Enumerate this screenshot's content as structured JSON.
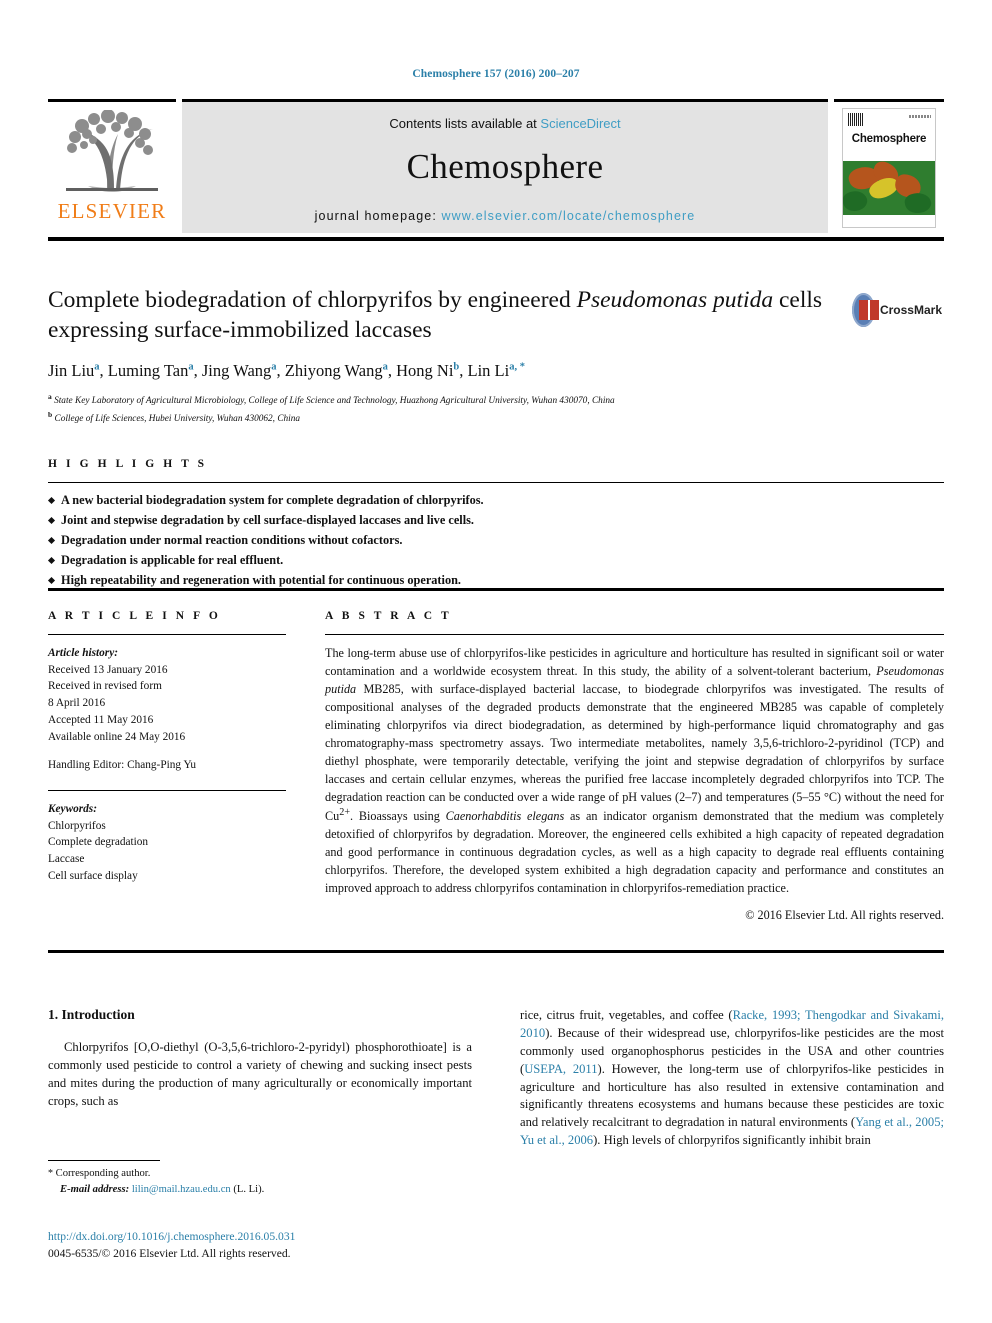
{
  "running_head": "Chemosphere 157 (2016) 200–207",
  "masthead": {
    "publisher_logo_label": "ELSEVIER",
    "contents_prefix": "Contents lists available at",
    "contents_link": "ScienceDirect",
    "journal_title": "Chemosphere",
    "homepage_prefix": "journal homepage:",
    "homepage_url": "www.elsevier.com/locate/chemosphere",
    "cover_journal_name": "Chemosphere"
  },
  "article": {
    "title_part1": "Complete biodegradation of chlorpyrifos by engineered ",
    "title_italic1": "Pseudomonas putida",
    "title_part2": " cells expressing surface-immobilized laccases",
    "crossmark_label": "CrossMark",
    "authors": [
      {
        "name": "Jin Liu",
        "marks": "a"
      },
      {
        "name": "Luming Tan",
        "marks": "a"
      },
      {
        "name": "Jing Wang",
        "marks": "a"
      },
      {
        "name": "Zhiyong Wang",
        "marks": "a"
      },
      {
        "name": "Hong Ni",
        "marks": "b"
      },
      {
        "name": "Lin Li",
        "marks": "a, *"
      }
    ],
    "affiliations": [
      {
        "mark": "a",
        "text": "State Key Laboratory of Agricultural Microbiology, College of Life Science and Technology, Huazhong Agricultural University, Wuhan 430070, China"
      },
      {
        "mark": "b",
        "text": "College of Life Sciences, Hubei University, Wuhan 430062, China"
      }
    ]
  },
  "highlights": {
    "heading": "H I G H L I G H T S",
    "items": [
      "A new bacterial biodegradation system for complete degradation of chlorpyrifos.",
      "Joint and stepwise degradation by cell surface-displayed laccases and live cells.",
      "Degradation under normal reaction conditions without cofactors.",
      "Degradation is applicable for real effluent.",
      "High repeatability and regeneration with potential for continuous operation."
    ]
  },
  "article_info": {
    "heading": "A R T I C L E  I N F O",
    "history_label": "Article history:",
    "history_lines": [
      "Received 13 January 2016",
      "Received in revised form",
      "8 April 2016",
      "Accepted 11 May 2016",
      "Available online 24 May 2016"
    ],
    "handling_editor": "Handling Editor: Chang-Ping Yu",
    "keywords_label": "Keywords:",
    "keywords": [
      "Chlorpyrifos",
      "Complete degradation",
      "Laccase",
      "Cell surface display"
    ]
  },
  "abstract": {
    "heading": "A B S T R A C T",
    "text_p1": "The long-term abuse use of chlorpyrifos-like pesticides in agriculture and horticulture has resulted in significant soil or water contamination and a worldwide ecosystem threat. In this study, the ability of a solvent-tolerant bacterium, ",
    "italic1": "Pseudomonas putida",
    "text_p2": " MB285, with surface-displayed bacterial laccase, to biodegrade chlorpyrifos was investigated. The results of compositional analyses of the degraded products demonstrate that the engineered MB285 was capable of completely eliminating chlorpyrifos via direct biodegradation, as determined by high-performance liquid chromatography and gas chromatography-mass spectrometry assays. Two intermediate metabolites, namely 3,5,6-trichloro-2-pyridinol (TCP) and diethyl phosphate, were temporarily detectable, verifying the joint and stepwise degradation of chlorpyrifos by surface laccases and certain cellular enzymes, whereas the purified free laccase incompletely degraded chlorpyrifos into TCP. The degradation reaction can be conducted over a wide range of pH values (2–7) and temperatures (5–55 °C) without the need for Cu",
    "sup1": "2+",
    "text_p3": ". Bioassays using ",
    "italic2": "Caenorhabditis elegans",
    "text_p4": " as an indicator organism demonstrated that the medium was completely detoxified of chlorpyrifos by degradation. Moreover, the engineered cells exhibited a high capacity of repeated degradation and good performance in continuous degradation cycles, as well as a high capacity to degrade real effluents containing chlorpyrifos. Therefore, the developed system exhibited a high degradation capacity and performance and constitutes an improved approach to address chlorpyrifos contamination in chlorpyrifos-remediation practice.",
    "copyright": "© 2016 Elsevier Ltd. All rights reserved."
  },
  "intro": {
    "heading": "1. Introduction",
    "left_p1": "Chlorpyrifos [O,O-diethyl (O-3,5,6-trichloro-2-pyridyl) phosphorothioate] is a commonly used pesticide to control a variety of chewing and sucking insect pests and mites during the production of many agriculturally or economically important crops, such as",
    "right_a": "rice, citrus fruit, vegetables, and coffee (",
    "right_ref1": "Racke, 1993; Thengodkar and Sivakami, 2010",
    "right_b": "). Because of their widespread use, chlorpyrifos-like pesticides are the most commonly used organophosphorus pesticides in the USA and other countries (",
    "right_ref2": "USEPA, 2011",
    "right_c": "). However, the long-term use of chlorpyrifos-like pesticides in agriculture and horticulture has also resulted in extensive contamination and significantly threatens ecosystems and humans because these pesticides are toxic and relatively recalcitrant to degradation in natural environments (",
    "right_ref3": "Yang et al., 2005; Yu et al., 2006",
    "right_d": "). High levels of chlorpyrifos significantly inhibit brain"
  },
  "footer": {
    "corresponding_star": "*",
    "corresponding_label": "Corresponding author.",
    "email_label": "E-mail address:",
    "email": "lilin@mail.hzau.edu.cn",
    "email_suffix": "(L. Li).",
    "doi_url": "http://dx.doi.org/10.1016/j.chemosphere.2016.05.031",
    "issn_line": "0045-6535/© 2016 Elsevier Ltd. All rights reserved."
  },
  "colors": {
    "link_blue": "#2a7fa8",
    "sciencedirect_blue": "#3f9dc4",
    "elsevier_orange": "#f07d18",
    "masthead_gray": "#e3e3e3"
  }
}
